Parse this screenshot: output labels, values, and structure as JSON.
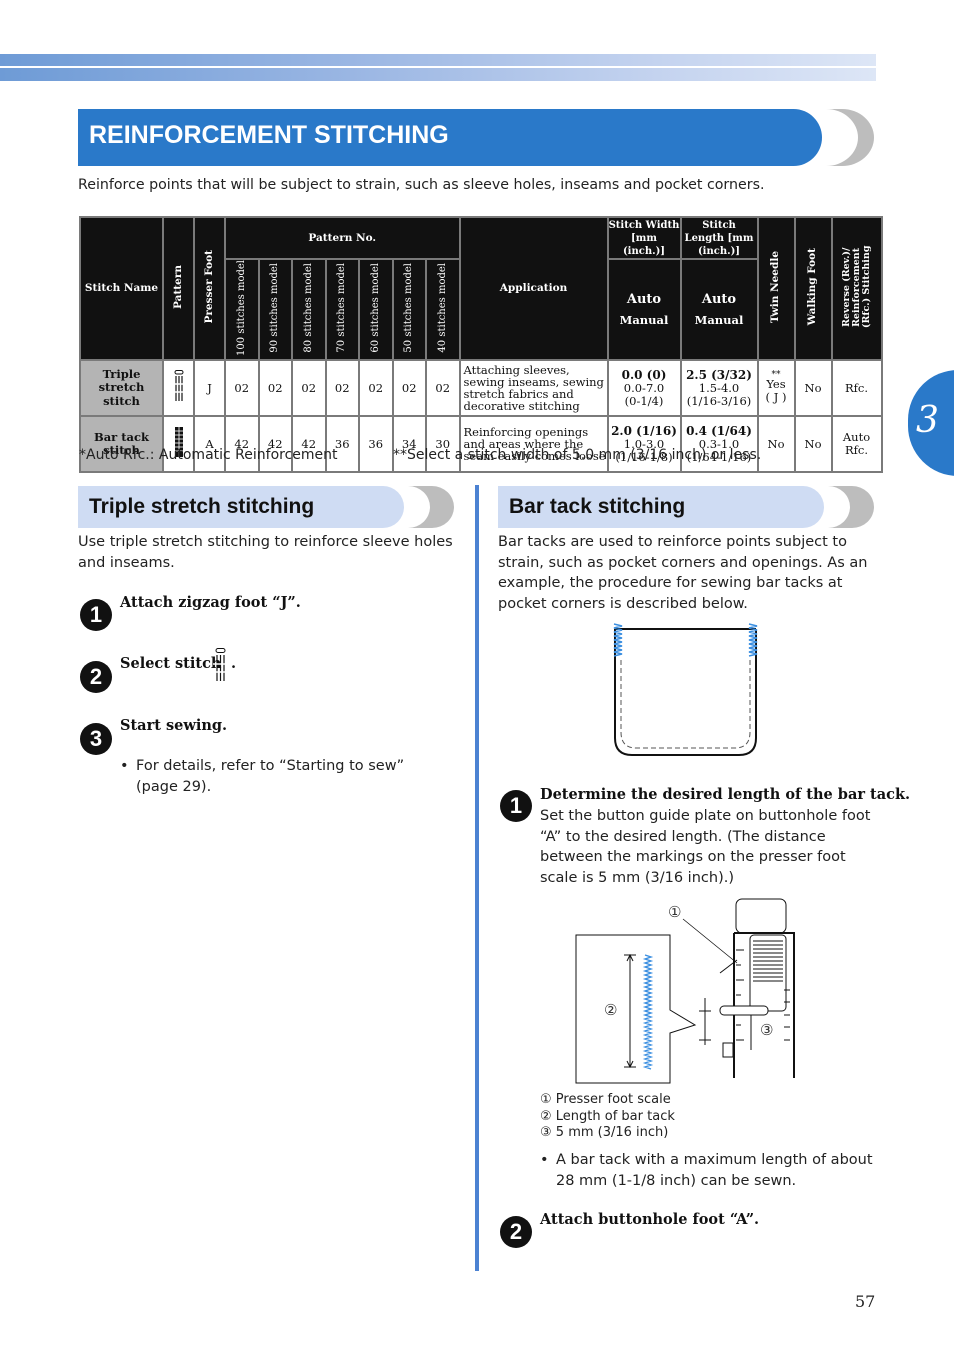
{
  "header": {
    "title": "REINFORCEMENT STITCHING",
    "intro": "Reinforce points that will be subject to strain, such as sleeve holes, inseams and pocket corners."
  },
  "chapter_tab": "3",
  "table": {
    "headers": {
      "stitch_name": "Stitch Name",
      "pattern": "Pattern",
      "presser_foot": "Presser Foot",
      "pattern_no": "Pattern No.",
      "models": [
        "100 stitches model",
        "90 stitches model",
        "80 stitches model",
        "70 stitches model",
        "60 stitches model",
        "50 stitches model",
        "40 stitches model"
      ],
      "application": "Application",
      "stitch_width": "Stitch Width [mm (inch.)]",
      "stitch_length": "Stitch Length [mm (inch.)]",
      "auto": "Auto",
      "manual": "Manual",
      "twin_needle": "Twin Needle",
      "walking_foot": "Walking Foot",
      "reverse": "Reverse (Rev.)/ Reinforcement (Rfc.) Stitching"
    },
    "rows": [
      {
        "name": "Triple stretch stitch",
        "pattern_icon": "triple-stretch-stitch-icon",
        "foot": "J",
        "pattern_nos": [
          "02",
          "02",
          "02",
          "02",
          "02",
          "02",
          "02"
        ],
        "application": "Attaching sleeves, sewing inseams, sewing stretch fabrics and decorative stitching",
        "width_auto": "0.0 (0)",
        "width_manual_mm": "0.0-7.0",
        "width_manual_in": "(0-1/4)",
        "length_auto": "2.5 (3/32)",
        "length_manual_mm": "1.5-4.0",
        "length_manual_in": "(1/16-3/16)",
        "twin_needle": "Yes",
        "twin_needle_mark": "**",
        "twin_needle_note": "( J )",
        "walking_foot": "No",
        "reverse": "Rfc.",
        "reverse_mark": ""
      },
      {
        "name": "Bar tack stitch",
        "pattern_icon": "bar-tack-stitch-icon",
        "foot": "A",
        "pattern_nos": [
          "42",
          "42",
          "42",
          "36",
          "36",
          "34",
          "30"
        ],
        "application": "Reinforcing openings and areas where the seam easily comes loose",
        "width_auto": "2.0 (1/16)",
        "width_manual_mm": "1.0-3.0",
        "width_manual_in": "(1/16-1/8)",
        "length_auto": "0.4 (1/64)",
        "length_manual_mm": "0.3-1.0",
        "length_manual_in": "(1/64-1/16)",
        "twin_needle": "No",
        "twin_needle_mark": "",
        "twin_needle_note": "",
        "walking_foot": "No",
        "reverse": "Auto Rfc.",
        "reverse_mark": "*"
      }
    ],
    "footnote1": "*Auto Rfc.: Automatic Reinforcement",
    "footnote2": "**Select a stitch width of 5.0 mm (3/16 inch) or less."
  },
  "triple": {
    "title": "Triple stretch stitching",
    "intro": "Use triple stretch stitching to reinforce sleeve holes and inseams.",
    "steps": [
      {
        "num": "1",
        "label": "Attach zigzag foot “J”."
      },
      {
        "num": "2",
        "label": "Select stitch",
        "suffix": "."
      },
      {
        "num": "3",
        "label": "Start sewing."
      }
    ],
    "bullet": "For details, refer to “Starting to sew” (page 29)."
  },
  "bartack": {
    "title": "Bar tack stitching",
    "intro": "Bar tacks are used to reinforce points subject to strain, such as pocket corners and openings. As an example, the procedure for sewing bar tacks at pocket corners is described below.",
    "step1_title": "Determine the desired length of the bar tack.",
    "step1_body": "Set the button guide plate on buttonhole foot “A” to the desired length. (The distance between the markings on the presser foot scale is 5 mm (3/16 inch).)",
    "step1_num": "1",
    "callouts": [
      "①",
      "②",
      "③"
    ],
    "legend": [
      {
        "mark": "①",
        "text": "Presser foot scale"
      },
      {
        "mark": "②",
        "text": "Length of bar tack"
      },
      {
        "mark": "③",
        "text": "5 mm (3/16 inch)"
      }
    ],
    "bullet": "A bar tack with a maximum length of about 28 mm (1-1/8 inch) can be sewn.",
    "step2_num": "2",
    "step2_title": "Attach buttonhole foot “A”."
  },
  "colors": {
    "accent": "#2a79c9",
    "section_bg": "#cfdcf3",
    "stitch_blue": "#3a8ee0"
  },
  "page_number": "57"
}
